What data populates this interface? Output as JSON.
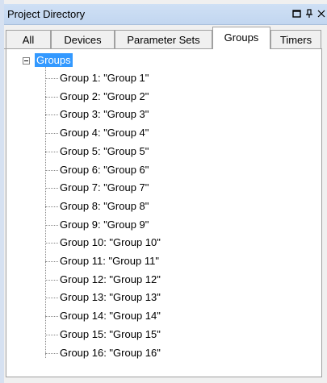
{
  "window": {
    "title": "Project Directory"
  },
  "titlebar_icons": [
    "pin-icon",
    "close-icon"
  ],
  "tabs": [
    {
      "label": "All",
      "active": false
    },
    {
      "label": "Devices",
      "active": false
    },
    {
      "label": "Parameter Sets",
      "active": false
    },
    {
      "label": "Groups",
      "active": true
    },
    {
      "label": "Timers",
      "active": false
    }
  ],
  "tree": {
    "root": "Groups",
    "items": [
      "Group 1: \"Group 1\"",
      "Group 2: \"Group 2\"",
      "Group 3: \"Group 3\"",
      "Group 4: \"Group 4\"",
      "Group 5: \"Group 5\"",
      "Group 6: \"Group 6\"",
      "Group 7: \"Group 7\"",
      "Group 8: \"Group 8\"",
      "Group 9: \"Group 9\"",
      "Group 10: \"Group 10\"",
      "Group 11: \"Group 11\"",
      "Group 12: \"Group 12\"",
      "Group 13: \"Group 13\"",
      "Group 14: \"Group 14\"",
      "Group 15: \"Group 15\"",
      "Group 16: \"Group 16\""
    ]
  },
  "colors": {
    "titlebar": "#c7daf2",
    "selection": "#3399ff"
  }
}
